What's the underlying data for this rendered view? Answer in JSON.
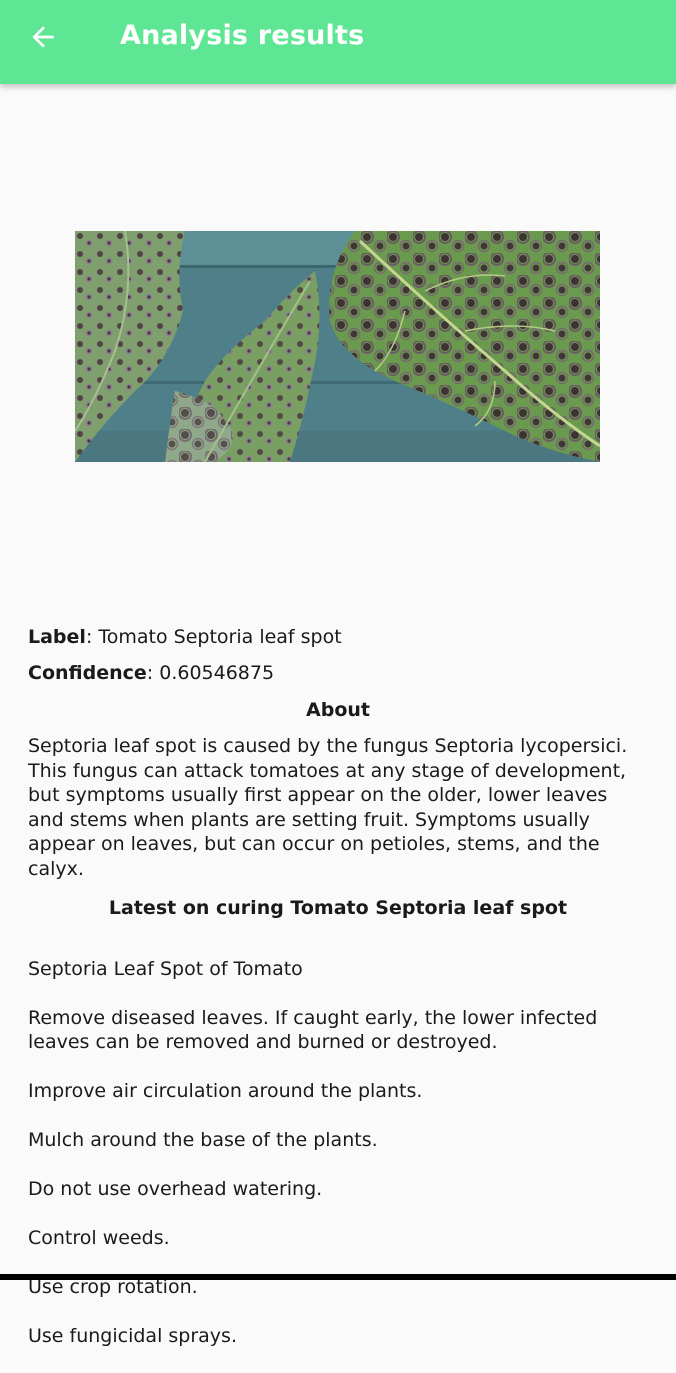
{
  "appbar": {
    "title": "Analysis results",
    "back_icon": "arrow-left-icon",
    "color": "#5fe695"
  },
  "result": {
    "label_key": "Label",
    "label_value": "Tomato Septoria leaf spot",
    "confidence_key": "Confidence",
    "confidence_value": "0.60546875"
  },
  "about": {
    "heading": "About",
    "text": "Septoria leaf spot is caused by the fungus Septoria lycopersici. This fungus can attack tomatoes at any stage of development, but symptoms usually first appear on the older, lower leaves and stems when plants are setting fruit. Symptoms usually appear on leaves, but can occur on petioles, stems, and the calyx."
  },
  "curing": {
    "heading": "Latest on curing Tomato Septoria leaf spot",
    "lines": [
      "Septoria Leaf Spot of Tomato",
      "Remove diseased leaves. If caught early, the lower infected leaves can be removed and burned or destroyed.",
      "Improve air circulation around the plants.",
      "Mulch around the base of the plants.",
      "Do not use overhead watering.",
      "Control weeds.",
      "Use crop rotation.",
      "Use fungicidal sprays."
    ]
  }
}
